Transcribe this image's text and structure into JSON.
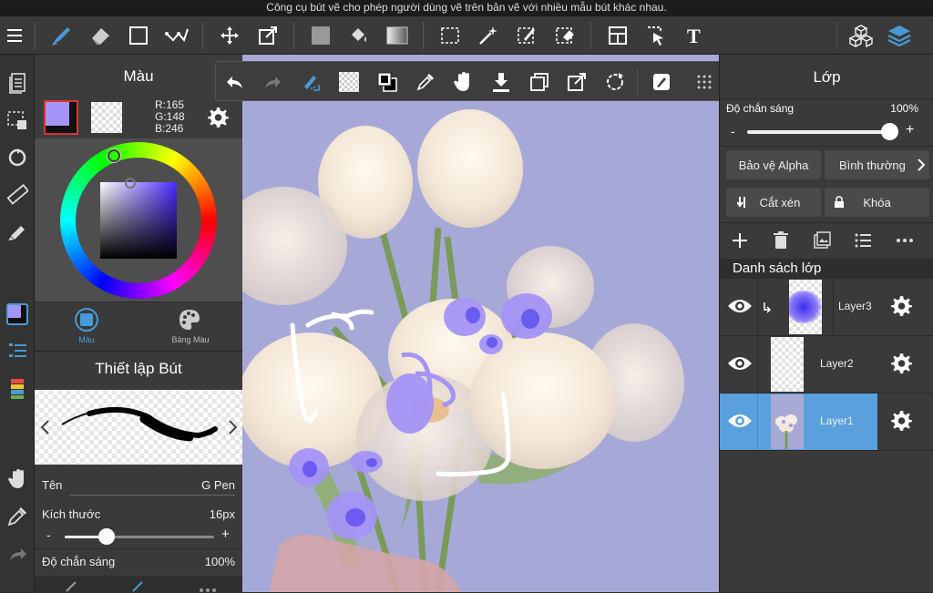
{
  "tooltip": "Công cụ bút vẽ cho phép người dùng vẽ trên bản vẽ với nhiều mẫu bút khác nhau.",
  "color_panel": {
    "title": "Màu",
    "r": "R:165",
    "g": "G:148",
    "b": "B:246",
    "tab_color": "Màu",
    "tab_palette": "Bảng Màu",
    "current_color": "#a594f6"
  },
  "brush_panel": {
    "title": "Thiết lập Bút",
    "name_label": "Tên",
    "name_value": "G Pen",
    "size_label": "Kích thước",
    "size_value": "16px",
    "size_minus": "-",
    "size_plus": "+",
    "opacity_label": "Độ chắn sáng",
    "opacity_value": "100%"
  },
  "layer_panel": {
    "title": "Lớp",
    "opacity_label": "Độ chắn sáng",
    "opacity_value": "100%",
    "opacity_minus": "-",
    "opacity_plus": "+",
    "alpha_protect": "Bảo vệ Alpha",
    "blend_mode": "Bình thường",
    "clipping": "Cắt xén",
    "lock": "Khóa",
    "list_title": "Danh sách lớp",
    "layers": [
      {
        "name": "Layer3",
        "selected": false
      },
      {
        "name": "Layer2",
        "selected": false
      },
      {
        "name": "Layer1",
        "selected": true
      }
    ]
  },
  "colors": {
    "accent": "#4a9ad6",
    "selected_layer": "#5aa0dc",
    "canvas_bg": "#a6a9d8",
    "stroke_color": "#a594f6"
  }
}
